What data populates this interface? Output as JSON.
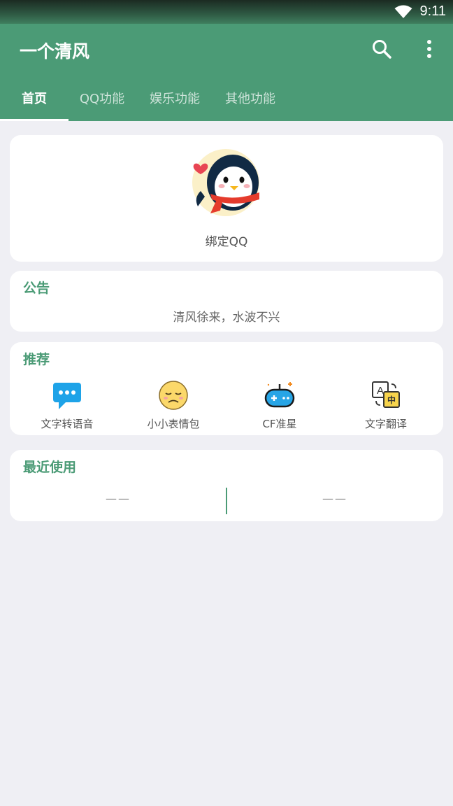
{
  "status_bar": {
    "time": "9:11",
    "wifi_icon": "wifi-icon"
  },
  "app_bar": {
    "title": "一个清风",
    "search_icon": "search-icon",
    "more_icon": "more-vert-icon",
    "color": "#4b9b76"
  },
  "tabs": [
    {
      "label": "首页",
      "active": true
    },
    {
      "label": "QQ功能",
      "active": false
    },
    {
      "label": "娱乐功能",
      "active": false
    },
    {
      "label": "其他功能",
      "active": false
    }
  ],
  "profile": {
    "label": "绑定QQ",
    "avatar_icon": "penguin-avatar-icon"
  },
  "notice": {
    "title": "公告",
    "text": "清风徐来，水波不兴"
  },
  "recommend": {
    "title": "推荐",
    "items": [
      {
        "label": "文字转语音",
        "icon": "chat-bubble-icon"
      },
      {
        "label": "小小表情包",
        "icon": "emoji-face-icon"
      },
      {
        "label": "CF准星",
        "icon": "gamepad-icon"
      },
      {
        "label": "文字翻译",
        "icon": "translate-icon"
      }
    ]
  },
  "recent": {
    "title": "最近使用",
    "slots": [
      "——",
      "——"
    ]
  },
  "colors": {
    "accent": "#4b9b76",
    "background": "#efeff4"
  }
}
